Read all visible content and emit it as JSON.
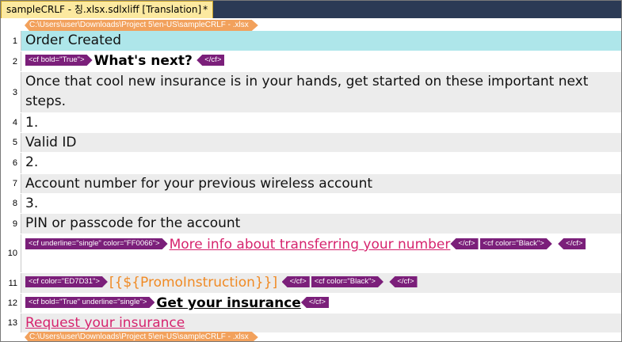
{
  "tab": {
    "title": "sampleCRLF - 칭.xlsx.sdlxliff [Translation]",
    "modified_marker": "*"
  },
  "file_path": "C:\\Users\\user\\Downloads\\Project 5\\en-US\\sampleCRLF - .xlsx",
  "file_path_end": "C:\\Users\\user\\Downloads\\Project 5\\en-US\\sampleCRLF - .xlsx",
  "rows": [
    {
      "num": "1",
      "text": "Order Created"
    },
    {
      "num": "2",
      "tag_open": "<cf bold=\"True\">",
      "text": "What's next?",
      "tag_close": "</cf>"
    },
    {
      "num": "3",
      "text": "Once that cool new insurance is in your hands, get started on these important next steps."
    },
    {
      "num": "4",
      "text": "1."
    },
    {
      "num": "5",
      "text": "Valid ID"
    },
    {
      "num": "6",
      "text": "2."
    },
    {
      "num": "7",
      "text": "Account number for your previous wireless account"
    },
    {
      "num": "8",
      "text": "3."
    },
    {
      "num": "9",
      "text": "PIN or passcode for the account"
    },
    {
      "num": "10",
      "tag_open": "<cf underline=\"single\" color=\"FF0066\">",
      "text": "More info about transferring your number",
      "tag_close1": "</cf>",
      "tag_open2": "<cf color=\"Black\">",
      "tag_close2": "</cf>"
    },
    {
      "num": "11",
      "tag_open": "<cf color=\"ED7D31\">",
      "text": "[{${PromoInstruction}}]",
      "tag_close1": "</cf>",
      "tag_open2": "<cf color=\"Black\">",
      "tag_close2": "</cf>"
    },
    {
      "num": "12",
      "tag_open": "<cf bold=\"True\" underline=\"single\">",
      "text": "Get your insurance",
      "tag_close": "</cf>"
    },
    {
      "num": "13",
      "text": "Request your insurance"
    }
  ]
}
